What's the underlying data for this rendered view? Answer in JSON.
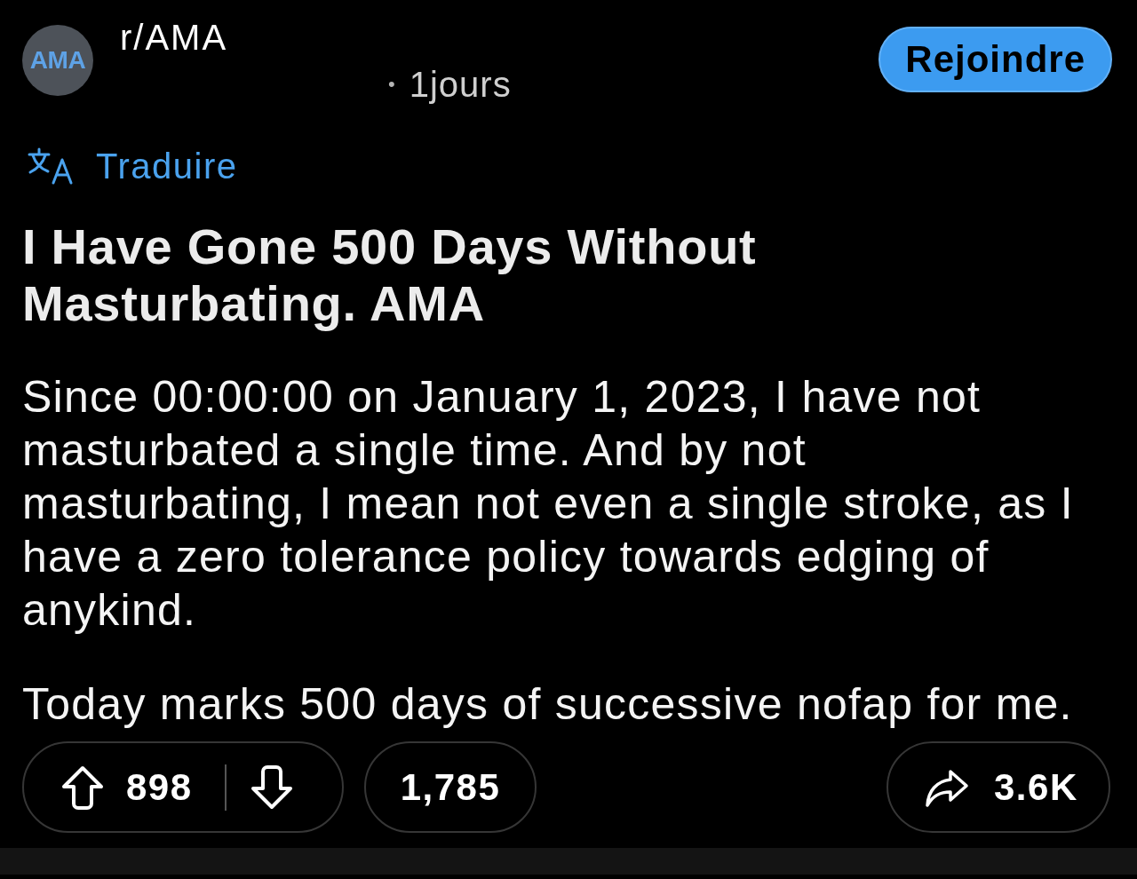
{
  "post_header": {
    "avatar_text": "AMA",
    "community": "r/AMA",
    "separator": "•",
    "age": "1jours",
    "join_button": "Rejoindre"
  },
  "translate": {
    "label": "Traduire"
  },
  "post": {
    "title": "I Have Gone 500 Days Without Masturbating. AMA",
    "paragraphs": [
      "Since 00:00:00 on January 1, 2023, I have not masturbated a single time. And by not masturbating, I mean not even a single stroke, as I have a zero tolerance policy towards edging of anykind.",
      "Today marks 500 days of successive nofap for me."
    ]
  },
  "actions": {
    "votes": "898",
    "comments": "1,785",
    "shares": "3.6K"
  }
}
